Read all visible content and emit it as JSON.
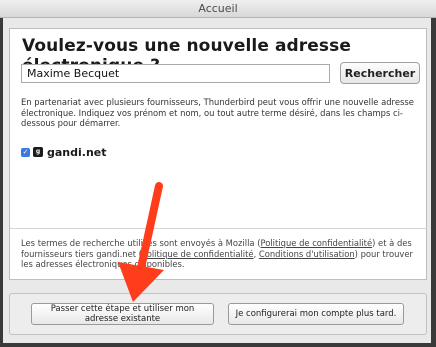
{
  "window": {
    "title": "Accueil"
  },
  "heading": "Voulez-vous une nouvelle adresse électronique ?",
  "search": {
    "value": "Maxime Becquet",
    "button_label": "Rechercher"
  },
  "description": "En partenariat avec plusieurs fournisseurs, Thunderbird peut vous offrir une nouvelle adresse électronique. Indiquez vos prénom et nom, ou tout autre terme désiré, dans les champs ci-dessous pour démarrer.",
  "provider": {
    "name": "gandi.net",
    "checked": true,
    "logo_icon": "gandi-logo-icon"
  },
  "terms": {
    "part1": "Les termes de recherche utilisés sont envoyés à Mozilla (",
    "link1": "Politique de confidentialité",
    "part2": ") et à des fournisseurs tiers gandi.net (",
    "link2": "Politique de confidentialité",
    "part3": ", ",
    "link3": "Conditions d'utilisation",
    "part4": ") pour trouver les adresses électroniques disponibles."
  },
  "buttons": {
    "skip_label": "Passer cette étape et utiliser mon adresse existante",
    "later_label": "Je configurerai mon compte plus tard."
  },
  "colors": {
    "arrow": "#ff3d1a",
    "checkbox": "#3b7ae0",
    "window_frame": "#3a3a3a"
  }
}
